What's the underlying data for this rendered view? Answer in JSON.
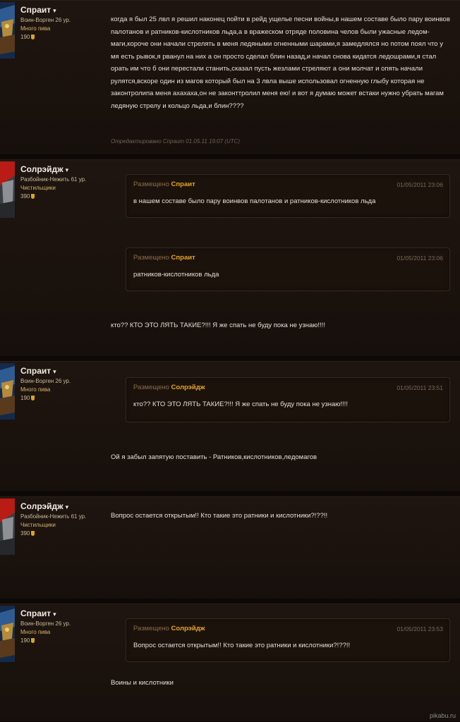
{
  "users": {
    "sprait": {
      "name": "Спраит",
      "class": "Воин-Ворген 26 ур.",
      "guild": "Много пива",
      "points": "190"
    },
    "solreidzh": {
      "name": "Солрэйдж",
      "class": "Разбойник-Нежить 61 ур.",
      "guild": "Чистильщики",
      "points": "390"
    }
  },
  "posts": [
    {
      "text": "когда я был 25 лвл я решил наконец пойти в рейд ущелье песни войны,в нашем составе было пару воинвов палотанов и ратников-кислотников льда,а в вражеском отряде половина челов были ужасные ледом-маги,короче они начали стрелять в меня ледяными огненными шарами,я замедлялся но потом поял что у мя есть рывок,я рванул на них а он просто сделал блин назад,и начал снова кидатся ледошрами,я стал орать им что б они перестали станить,сказал пусть жезлами стреляют а они молчат и опять начали рулятся,вскоре один из магов который был на 3 лвла выше использовал огненную глыбу которая не законтролипа меня ахахаха,он не законттролил меня ею! и вот я думаю может встаки нужно убрать магам ледяную стрелу и кольцо льда,и блин????",
      "edited": "Отредактировано Спраит 01.05.11 19:07 (UTC)"
    },
    {
      "quotes": [
        {
          "label": "Размещено",
          "author": "Спраит",
          "date": "01/05/2011 23:06",
          "text": "в нашем составе было пару воинвов палотанов и ратников-кислотников льда"
        },
        {
          "label": "Размещено",
          "author": "Спраит",
          "date": "01/05/2011 23:06",
          "text": "ратников-кислотников льда"
        }
      ],
      "text": "кто?? КТО ЭТО ЛЯТЬ ТАКИЕ?!!! Я же спать не буду пока не узнаю!!!!"
    },
    {
      "quotes": [
        {
          "label": "Размещено",
          "author": "Солрэйдж",
          "date": "01/05/2011 23:51",
          "text": "кто?? КТО ЭТО ЛЯТЬ ТАКИЕ?!!! Я же спать не буду пока не узнаю!!!!"
        }
      ],
      "text": "Ой я забыл запятую поставить - Ратников,кислотников,ледомагов"
    },
    {
      "text": "Вопрос остается открытым!! Кто такие это ратники и кислотники?!??!!"
    },
    {
      "quotes": [
        {
          "label": "Размещено",
          "author": "Солрэйдж",
          "date": "01/05/2011 23:53",
          "text": "Вопрос остается открытым!! Кто такие это ратники и кислотники?!??!!"
        }
      ],
      "text": "Воины и кислотники"
    }
  ],
  "footer": "pikabu.ru",
  "colors": {
    "accent": "#e7a52a",
    "background": "#1a120d",
    "guild": "#d6b46a"
  }
}
